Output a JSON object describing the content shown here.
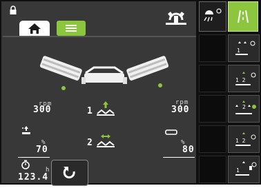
{
  "colors": {
    "accent": "#8cc63e",
    "panel": "#383838",
    "background": "#101010"
  },
  "header": {
    "lock_icon": "lock-icon",
    "home_icon": "home-icon",
    "menu_icon": "menu-icon",
    "status_icon": "mower-status-icon"
  },
  "left_rotor": {
    "unit": "rpm",
    "value": "300"
  },
  "right_rotor": {
    "unit": "rpm",
    "value": "300"
  },
  "function_1": {
    "number": "1",
    "icon": "lift-all-icon"
  },
  "function_2": {
    "number": "2",
    "icon": "float-icon"
  },
  "left_pressure": {
    "unit": "%",
    "value": "70",
    "icon": "pressure-icon"
  },
  "right_pressure": {
    "unit": "%",
    "value": "80",
    "icon": "gap-icon"
  },
  "hours": {
    "unit": "h",
    "value": "123.4",
    "icon": "stopwatch-icon"
  },
  "back_button": {
    "icon": "reset-icon"
  },
  "side_panel": {
    "tab_left_icon": "light-icon",
    "tab_right_icon": "road-mode-icon",
    "buttons": [
      {
        "icon": "unit-lift-icon",
        "number": "1"
      },
      {
        "icon": "lift-12-icon",
        "number": "1 2"
      },
      {
        "icon": "lift-all-icon",
        "number": "2"
      },
      {
        "icon": "lower-12-icon",
        "number": "1 2"
      },
      {
        "icon": "unit-lower-icon",
        "number": "1"
      }
    ]
  }
}
